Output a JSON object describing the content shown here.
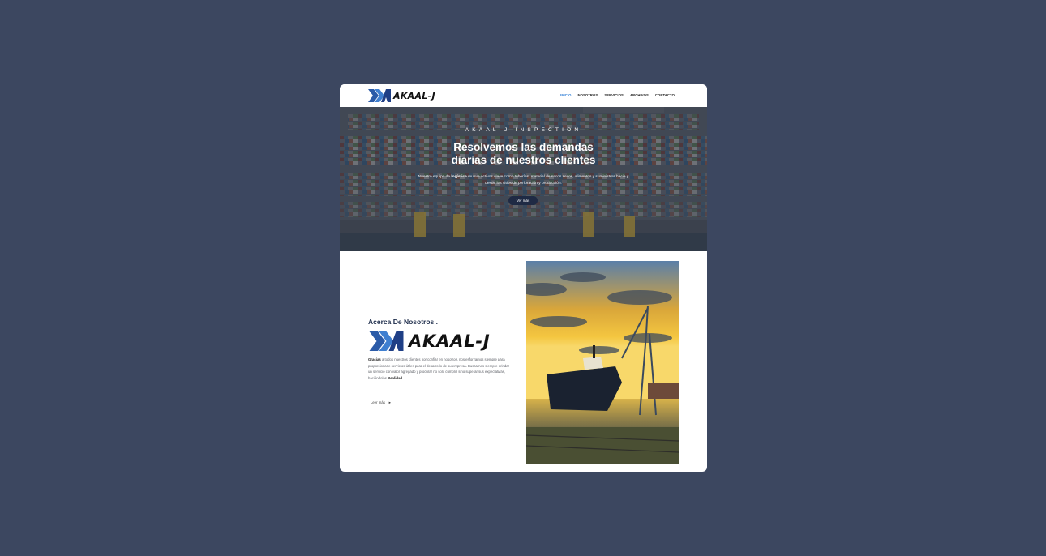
{
  "colors": {
    "background": "#3c4760",
    "accent": "#2a7bd6",
    "brand_blue": "#2b5ba8",
    "navy": "#1c2b4a"
  },
  "brand": {
    "name": "AKAAL-J"
  },
  "nav": {
    "items": [
      {
        "label": "INICIO",
        "active": true
      },
      {
        "label": "NOSOTROS"
      },
      {
        "label": "SERVICIOS"
      },
      {
        "label": "ARCHIVOS"
      },
      {
        "label": "CONTACTO"
      }
    ]
  },
  "hero": {
    "kicker": "AKAAL-J INSPECTION",
    "title_line1": "Resolvemos las demandas",
    "title_line2": "diarias de nuestros clientes",
    "desc_pre": "Nuestro equipo de ",
    "desc_bold": "logística",
    "desc_post": " mueve activos clave como tuberías, material de sacos secos, alimentos y suministros hacia y desde los sitios de perforación y producción.",
    "button": "Ver más"
  },
  "about": {
    "heading": "Acerca De Nosotros .",
    "text_bold_start": "Gracias",
    "text_body": " a todos nuestros clientes por confiar en nosotros, nos esforzamos siempre para proporcionarle servicios útiles para el desarrollo de su empresa. Buscamos siempre brindar un servicio con valor agregado y procurar no solo cumplir, sino superar sus expectativas, haciéndolas ",
    "text_bold_end": "Realidad.",
    "link": "Leer más",
    "link_icon": "arrow-right-icon"
  }
}
